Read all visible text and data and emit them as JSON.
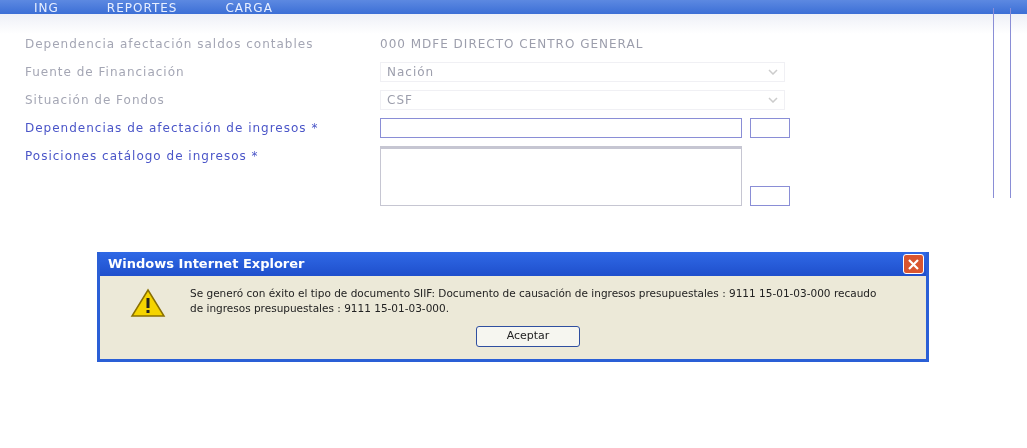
{
  "menu": [
    "ING",
    "REPORTES",
    "CARGA"
  ],
  "form": {
    "fields": [
      {
        "kind": "text",
        "label": "Dependencia afectación saldos contables",
        "value": "000 MDFE DIRECTO CENTRO GENERAL",
        "disabled": true
      },
      {
        "kind": "select",
        "label": "Fuente de Financiación",
        "value": "Nación",
        "disabled": true
      },
      {
        "kind": "select",
        "label": "Situación de Fondos",
        "value": "CSF",
        "disabled": true
      },
      {
        "kind": "input",
        "label": "Dependencias de afectación de ingresos *",
        "disabled": false
      },
      {
        "kind": "textarea",
        "label": "Posiciones catálogo de ingresos *",
        "disabled": false
      }
    ]
  },
  "dialog": {
    "title": "Windows Internet Explorer",
    "message": "Se generó con éxito el tipo de documento SIIF: Documento de causación de ingresos presupuestales : 9111 15-01-03-000 recaudo de ingresos presupuestales : 9111 15-01-03-000.",
    "button": "Aceptar"
  }
}
